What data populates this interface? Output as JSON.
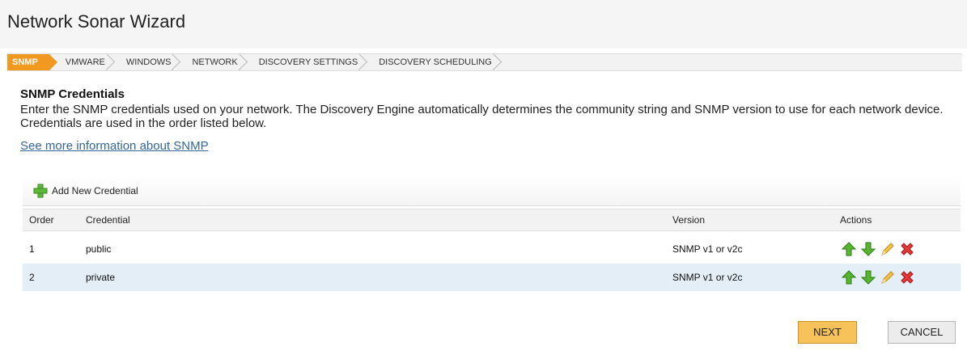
{
  "page": {
    "title": "Network Sonar Wizard"
  },
  "steps": [
    {
      "label": "SNMP",
      "active": true
    },
    {
      "label": "VMWARE",
      "active": false
    },
    {
      "label": "WINDOWS",
      "active": false
    },
    {
      "label": "NETWORK",
      "active": false
    },
    {
      "label": "DISCOVERY SETTINGS",
      "active": false
    },
    {
      "label": "DISCOVERY SCHEDULING",
      "active": false
    }
  ],
  "section": {
    "title": "SNMP Credentials",
    "description": "Enter the SNMP credentials used on your network. The Discovery Engine automatically determines the community string and SNMP version to use for each network device. Credentials are used in the order listed below.",
    "link": "See more information about SNMP"
  },
  "toolbar": {
    "add_label": "Add New Credential"
  },
  "grid": {
    "headers": {
      "order": "Order",
      "credential": "Credential",
      "version": "Version",
      "actions": "Actions"
    },
    "rows": [
      {
        "order": "1",
        "credential": "public",
        "version": "SNMP v1 or v2c"
      },
      {
        "order": "2",
        "credential": "private",
        "version": "SNMP v1 or v2c"
      }
    ],
    "action_icons": [
      "move-up-icon",
      "move-down-icon",
      "edit-pencil-icon",
      "delete-icon"
    ]
  },
  "buttons": {
    "next": "NEXT",
    "cancel": "CANCEL"
  },
  "colors": {
    "accent": "#f0981f",
    "link": "#336699",
    "selected_row": "#e4eef7",
    "next_button": "#f8c25a"
  }
}
